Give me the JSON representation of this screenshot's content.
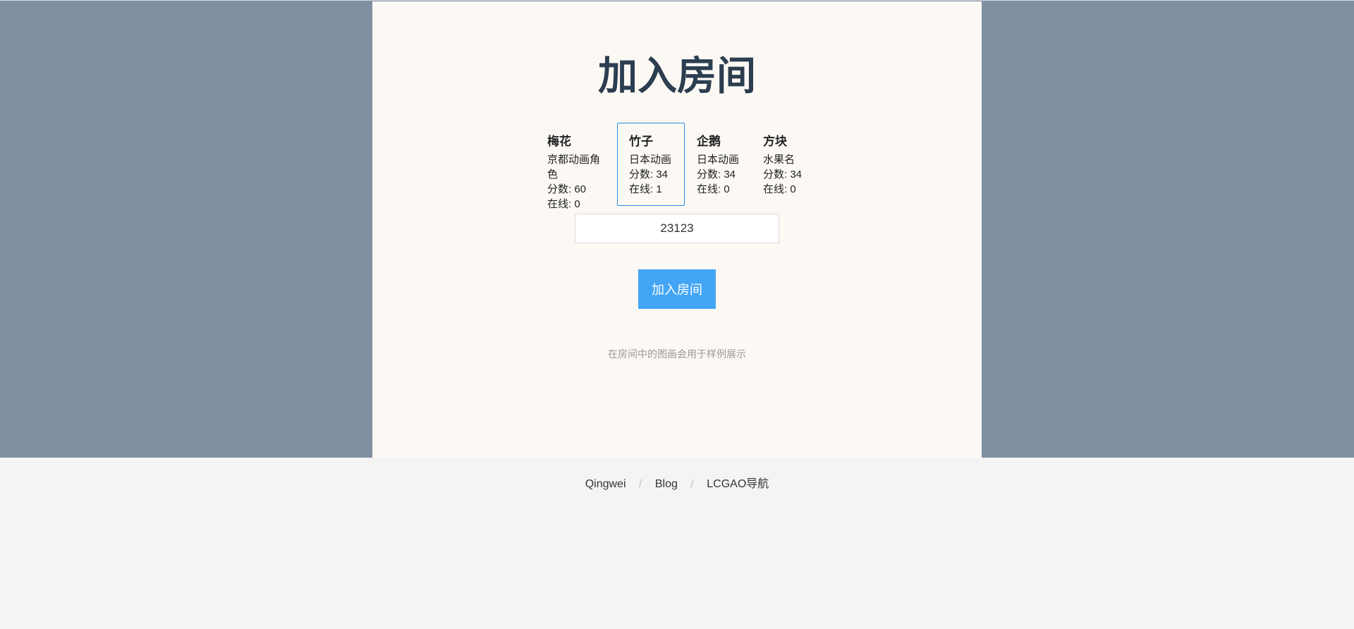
{
  "page": {
    "title": "加入房间",
    "hint": "在房间中的图画会用于样例展示"
  },
  "rooms": [
    {
      "name": "梅花",
      "category": "京都动画角色",
      "score": "分数: 60",
      "online": "在线: 0",
      "selected": false
    },
    {
      "name": "竹子",
      "category": "日本动画",
      "score": "分数: 34",
      "online": "在线: 1",
      "selected": true
    },
    {
      "name": "企鹅",
      "category": "日本动画",
      "score": "分数: 34",
      "online": "在线: 0",
      "selected": false
    },
    {
      "name": "方块",
      "category": "水果名",
      "score": "分数: 34",
      "online": "在线: 0",
      "selected": false
    }
  ],
  "room_input": {
    "value": "23123"
  },
  "join_button": {
    "label": "加入房间"
  },
  "footer": {
    "links": [
      "Qingwei",
      "Blog",
      "LCGAO导航"
    ],
    "separator": "/"
  },
  "colors": {
    "page_band": "#7f8fa2",
    "card_background": "#fcf9f5",
    "footer_background": "#f4f4f4",
    "title": "#2c3e50",
    "accent": "#42a5f5",
    "selected_border": "#2b8be6"
  }
}
